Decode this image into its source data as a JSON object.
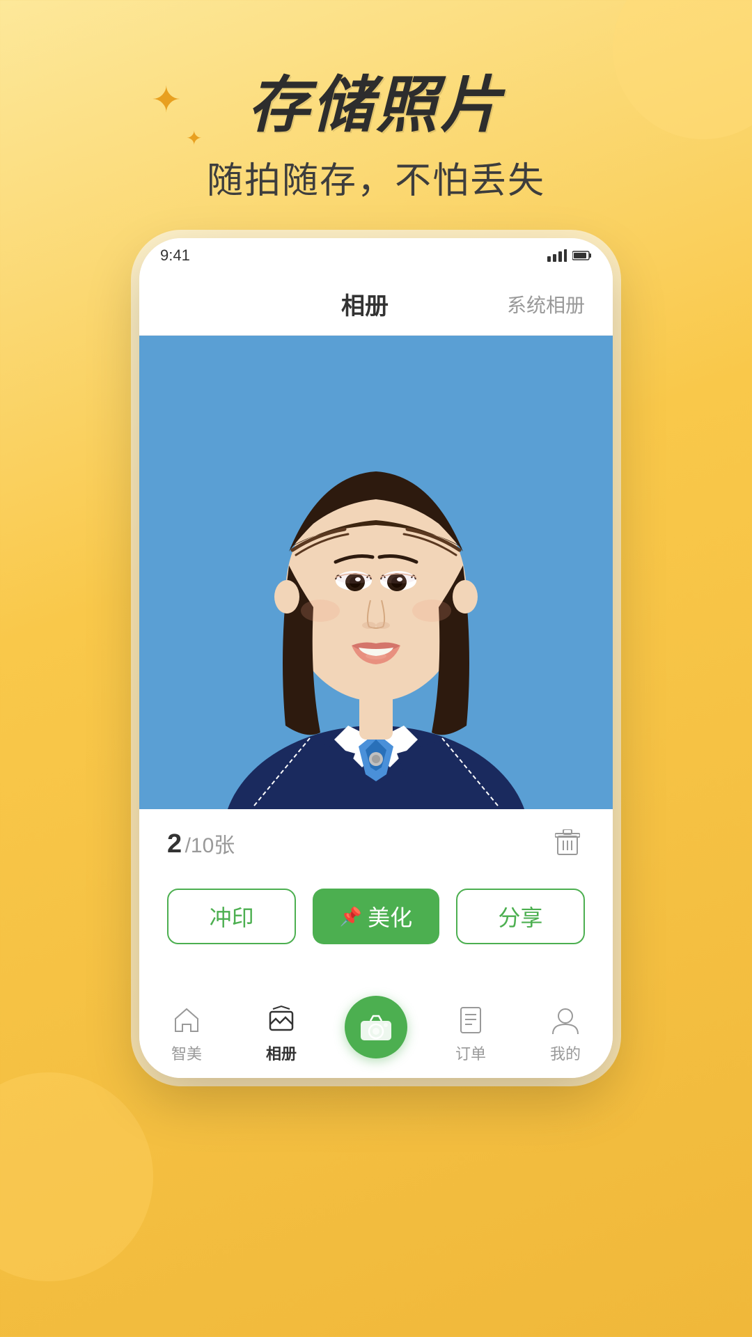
{
  "page": {
    "background_color": "#f9c84a",
    "title": "存储照片",
    "subtitle": "随拍随存，不怕丢失"
  },
  "header": {
    "title_label": "存储照片",
    "subtitle_label": "随拍随存，不怕丢失"
  },
  "phone": {
    "album_tab": "相册",
    "system_album_tab": "系统相册",
    "photo_current": "2",
    "photo_total": "/10张",
    "btn_print": "冲印",
    "btn_beautify": "美化",
    "btn_share": "分享"
  },
  "bottom_nav": {
    "items": [
      {
        "label": "智美",
        "icon": "home-icon",
        "active": false
      },
      {
        "label": "相册",
        "icon": "album-icon",
        "active": true
      },
      {
        "label": "",
        "icon": "camera-icon",
        "active": false,
        "center": true
      },
      {
        "label": "订单",
        "icon": "order-icon",
        "active": false
      },
      {
        "label": "我的",
        "icon": "profile-icon",
        "active": false
      }
    ]
  },
  "sparkles": {
    "large": "✦",
    "small": "✦"
  }
}
